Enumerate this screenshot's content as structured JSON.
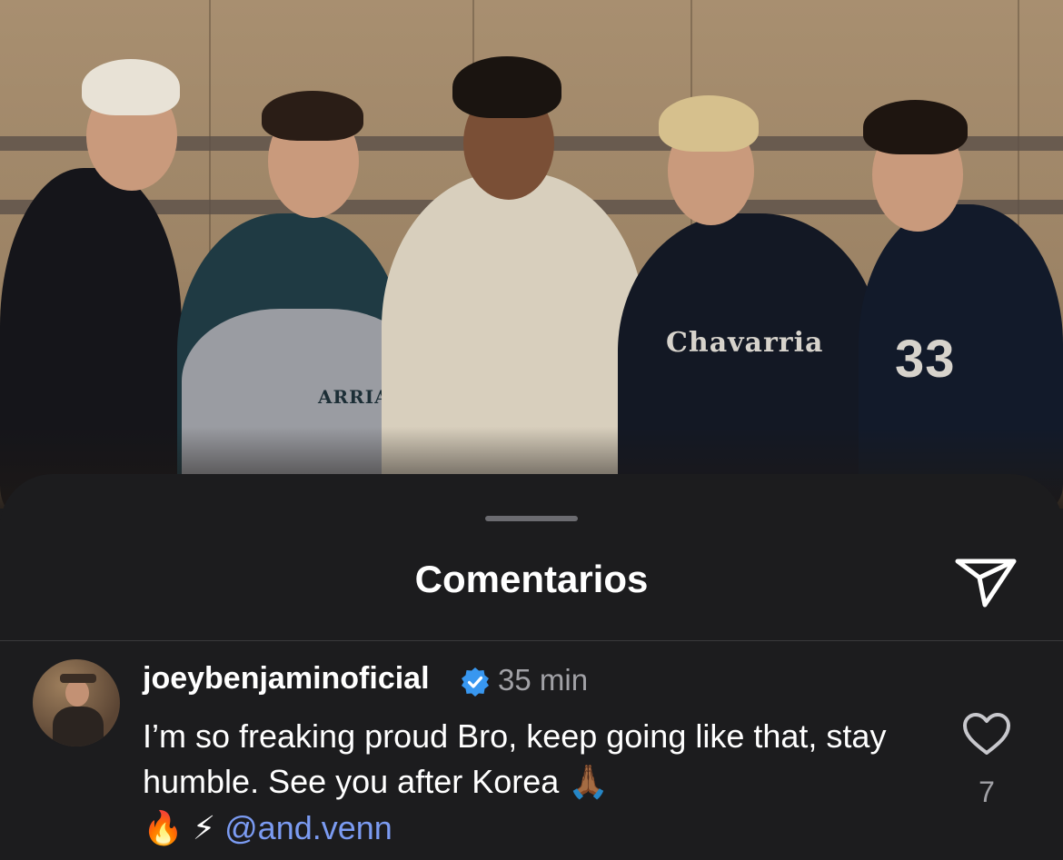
{
  "photo": {
    "alt": "Group photo of five young men",
    "jersey_text": "Chavarria",
    "jersey_number": "33",
    "sleeve_text": "ARRIA"
  },
  "sheet": {
    "title": "Comentarios",
    "share_icon": "paper-plane-icon"
  },
  "comment": {
    "username": "joeybenjaminoficial",
    "verified": true,
    "time": "35 min",
    "text_main": "I’m so freaking proud Bro, keep going like that, stay humble. See you after Korea ",
    "emoji_pray": "🙏🏾",
    "emoji_fire": "🔥",
    "emoji_bolt": "⚡",
    "mention": "@and.venn",
    "likes": "7",
    "like_icon": "heart-outline-icon"
  },
  "colors": {
    "sheet_bg": "#1c1c1e",
    "mention": "#7b9bf2",
    "secondary_text": "#a1a1a6",
    "verified_badge": "#3897f0"
  }
}
